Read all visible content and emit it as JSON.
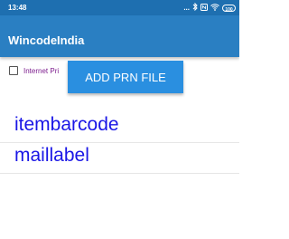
{
  "status_bar": {
    "time": "13:48",
    "icons": [
      "more-dots-icon",
      "bluetooth-icon",
      "nfc-icon",
      "wifi-icon",
      "battery-icon"
    ],
    "dots": "...",
    "battery_level": "100"
  },
  "app_bar": {
    "title": "WincodeIndia"
  },
  "controls": {
    "checkbox_label": "Internet Pri",
    "checkbox_checked": false,
    "add_prn_button": "ADD PRN FILE"
  },
  "list": {
    "items": [
      {
        "label": "itembarcode"
      },
      {
        "label": "maillabel"
      }
    ]
  },
  "colors": {
    "status_bar": "#1e6fb0",
    "app_bar": "#2a7fc2",
    "button": "#2a8fe0",
    "list_text": "#1a16e6",
    "checkbox_label": "#7d1d8e"
  }
}
